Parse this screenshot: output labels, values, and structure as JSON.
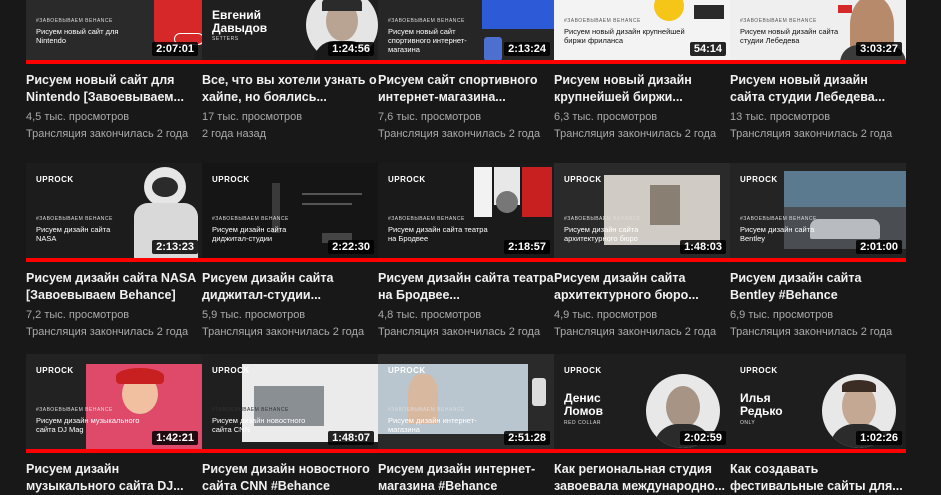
{
  "rows": [
    [
      {
        "thumb": {
          "logo": "",
          "tag": "#ЗАВОЕВЫВАЕМ BEHANCE",
          "text": "Рисуем новый сайт для Nintendo",
          "name": "",
          "sub": "",
          "duration": "2:07:01"
        },
        "title": "Рисуем новый сайт для Nintendo [Завоевываем...",
        "views": "4,5 тыс. просмотров",
        "age": "Трансляция закончилась 2 года"
      },
      {
        "thumb": {
          "logo": "",
          "tag": "",
          "text": "",
          "name": "Евгений Давыдов",
          "sub": "SETTERS",
          "duration": "1:24:56"
        },
        "title": "Все, что вы хотели узнать о хайпе, но боялись...",
        "views": "17 тыс. просмотров",
        "age": "2 года назад"
      },
      {
        "thumb": {
          "logo": "",
          "tag": "#ЗАВОЕВЫВАЕМ BEHANCE",
          "text": "Рисуем новый сайт спортивного интернет-магазина",
          "name": "",
          "sub": "",
          "duration": "2:13:24"
        },
        "title": "Рисуем сайт спортивного интернет-магазина...",
        "views": "7,6 тыс. просмотров",
        "age": "Трансляция закончилась 2 года"
      },
      {
        "thumb": {
          "logo": "",
          "tag": "#ЗАВОЕВЫВАЕМ BEHANCE",
          "text": "Рисуем новый дизайн крупнейшей биржи фриланса",
          "name": "",
          "sub": "",
          "duration": "54:14"
        },
        "title": "Рисуем новый дизайн крупнейшей биржи...",
        "views": "6,3 тыс. просмотров",
        "age": "Трансляция закончилась 2 года"
      },
      {
        "thumb": {
          "logo": "",
          "tag": "#ЗАВОЕВЫВАЕМ BEHANCE",
          "text": "Рисуем новый дизайн сайта студии Лебедева",
          "name": "",
          "sub": "",
          "duration": "3:03:27"
        },
        "title": "Рисуем новый дизайн сайта студии Лебедева...",
        "views": "13 тыс. просмотров",
        "age": "Трансляция закончилась 2 года"
      }
    ],
    [
      {
        "thumb": {
          "logo": "UPROCK",
          "tag": "#ЗАВОЕВЫВАЕМ BEHANCE",
          "text": "Рисуем дизайн сайта NASA",
          "name": "",
          "sub": "",
          "duration": "2:13:23"
        },
        "title": "Рисуем дизайн сайта NASA [Завоевываем Behance]",
        "views": "7,2 тыс. просмотров",
        "age": "Трансляция закончилась 2 года"
      },
      {
        "thumb": {
          "logo": "UPROCK",
          "tag": "#ЗАВОЕВЫВАЕМ BEHANCE",
          "text": "Рисуем дизайн сайта диджитал-студии",
          "name": "",
          "sub": "",
          "duration": "2:22:30"
        },
        "title": "Рисуем дизайн сайта диджитал-студии...",
        "views": "5,9 тыс. просмотров",
        "age": "Трансляция закончилась 2 года"
      },
      {
        "thumb": {
          "logo": "UPROCK",
          "tag": "#ЗАВОЕВЫВАЕМ BEHANCE",
          "text": "Рисуем дизайн сайта театра на Бродвее",
          "name": "",
          "sub": "",
          "duration": "2:18:57"
        },
        "title": "Рисуем дизайн сайта театра на Бродвее...",
        "views": "4,8 тыс. просмотров",
        "age": "Трансляция закончилась 2 года"
      },
      {
        "thumb": {
          "logo": "UPROCK",
          "tag": "#ЗАВОЕВЫВАЕМ BEHANCE",
          "text": "Рисуем дизайн сайта архитектурного бюро",
          "name": "",
          "sub": "",
          "duration": "1:48:03"
        },
        "title": "Рисуем дизайн сайта архитектурного бюро...",
        "views": "4,9 тыс. просмотров",
        "age": "Трансляция закончилась 2 года"
      },
      {
        "thumb": {
          "logo": "UPROCK",
          "tag": "#ЗАВОЕВЫВАЕМ BEHANCE",
          "text": "Рисуем дизайн сайта Bentley",
          "name": "",
          "sub": "",
          "duration": "2:01:00"
        },
        "title": "Рисуем дизайн сайта Bentley #Behance",
        "views": "6,9 тыс. просмотров",
        "age": "Трансляция закончилась 2 года"
      }
    ],
    [
      {
        "thumb": {
          "logo": "UPROCK",
          "tag": "#ЗАВОЕВЫВАЕМ BEHANCE",
          "text": "Рисуем дизайн музыкального сайта DJ Mag",
          "name": "",
          "sub": "",
          "duration": "1:42:21"
        },
        "title": "Рисуем дизайн музыкального сайта DJ...",
        "views": "",
        "age": ""
      },
      {
        "thumb": {
          "logo": "UPROCK",
          "tag": "#ЗАВОЕВЫВАЕМ BEHANCE",
          "text": "Рисуем дизайн новостного сайта CNN",
          "name": "",
          "sub": "",
          "duration": "1:48:07"
        },
        "title": "Рисуем дизайн новостного сайта CNN #Behance",
        "views": "",
        "age": ""
      },
      {
        "thumb": {
          "logo": "UPROCK",
          "tag": "#ЗАВОЕВЫВАЕМ BEHANCE",
          "text": "Рисуем дизайн интернет-магазина",
          "name": "",
          "sub": "",
          "duration": "2:51:28"
        },
        "title": "Рисуем дизайн интернет-магазина #Behance",
        "views": "",
        "age": ""
      },
      {
        "thumb": {
          "logo": "UPROCK",
          "tag": "",
          "text": "",
          "name": "Денис Ломов",
          "sub": "RED COLLAR",
          "duration": "2:02:59"
        },
        "title": "Как региональная студия завоевала международно...",
        "views": "",
        "age": ""
      },
      {
        "thumb": {
          "logo": "UPROCK",
          "tag": "",
          "text": "",
          "name": "Илья Редько",
          "sub": "ONLY",
          "duration": "1:02:26"
        },
        "title": "Как создавать фестивальные сайты для...",
        "views": "",
        "age": ""
      }
    ]
  ]
}
